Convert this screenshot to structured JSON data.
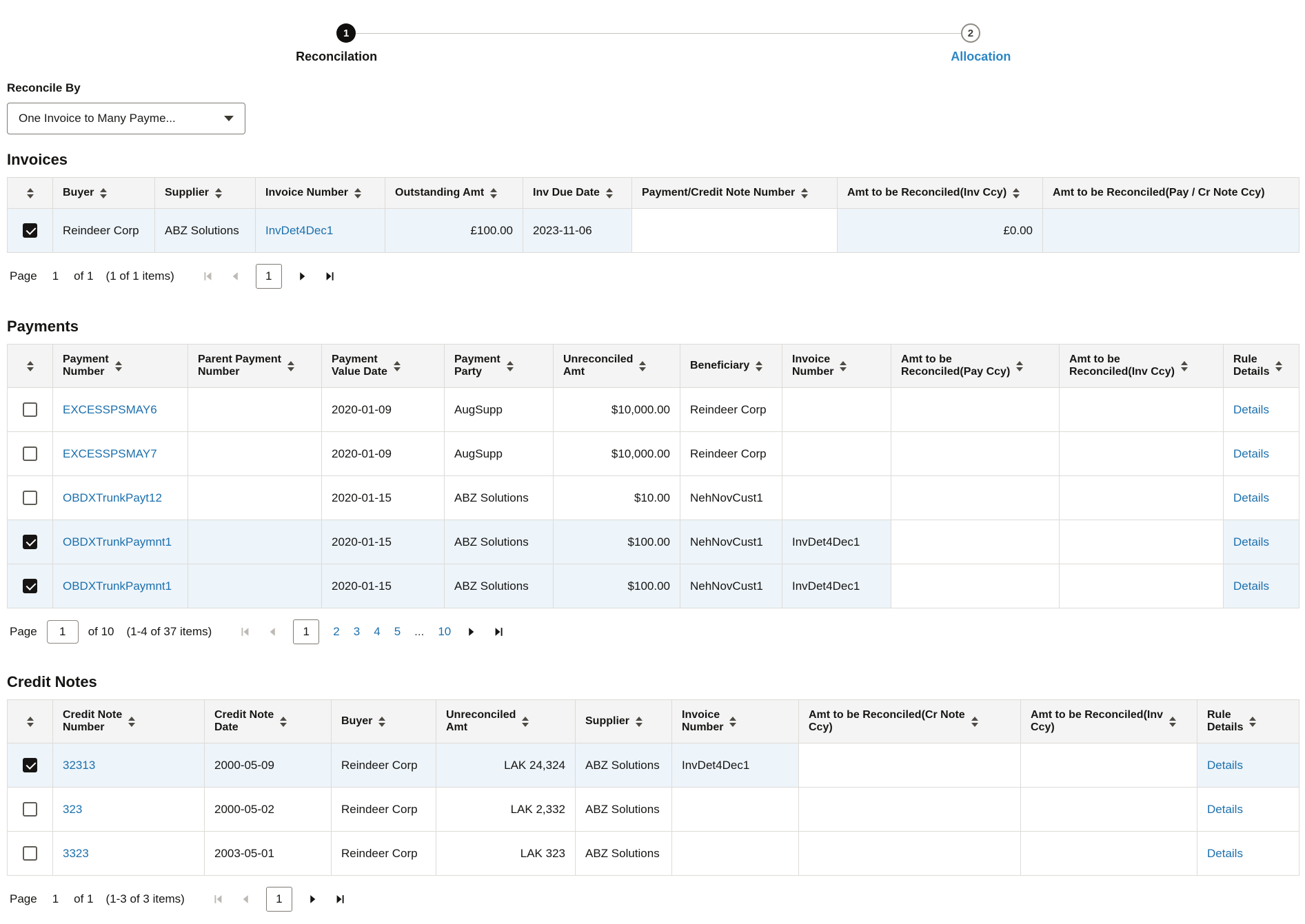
{
  "colors": {
    "link": "#1C70AD",
    "selected-row-bg": "#EDF4FA",
    "header-bg": "#F4F4F4",
    "step-active-bg": "#100F0E",
    "step-label-next": "#2B86C4",
    "border": "#DEDBD7",
    "text": "#161513"
  },
  "stepper": {
    "steps": [
      {
        "number": "1",
        "label": "Reconcilation"
      },
      {
        "number": "2",
        "label": "Allocation"
      }
    ]
  },
  "reconcile_by": {
    "label": "Reconcile By",
    "value": "One Invoice to Many Payme..."
  },
  "invoices": {
    "title": "Invoices",
    "columns": [
      "Buyer",
      "Supplier",
      "Invoice Number",
      "Outstanding Amt",
      "Inv Due Date",
      "Payment/Credit Note Number",
      "Amt to be Reconciled(Inv Ccy)",
      "Amt to be Reconciled(Pay / Cr Note Ccy)"
    ],
    "rows": [
      {
        "checked": true,
        "buyer": "Reindeer Corp",
        "supplier": "ABZ Solutions",
        "invoice_number": "InvDet4Dec1",
        "outstanding_amt": "£100.00",
        "inv_due_date": "2023-11-06",
        "payment_credit_note_number": "",
        "amt_to_be_reconciled_inv_ccy": "£0.00",
        "amt_to_be_reconciled_pay_cr_note_ccy": ""
      }
    ],
    "pagination": {
      "page_label": "Page",
      "page_value": "1",
      "of_label": "of 1",
      "items_label": "(1 of 1 items)",
      "current_page": "1"
    }
  },
  "payments": {
    "title": "Payments",
    "columns": [
      "Payment\nNumber",
      "Parent Payment\nNumber",
      "Payment\nValue Date",
      "Payment\nParty",
      "Unreconciled\nAmt",
      "Beneficiary",
      "Invoice\nNumber",
      "Amt to be\nReconciled(Pay Ccy)",
      "Amt to be\nReconciled(Inv Ccy)",
      "Rule\nDetails"
    ],
    "rows": [
      {
        "checked": false,
        "payment_number": "EXCESSPSMAY6",
        "parent_payment_number": "",
        "payment_value_date": "2020-01-09",
        "payment_party": "AugSupp",
        "unreconciled_amt": "$10,000.00",
        "beneficiary": "Reindeer Corp",
        "invoice_number": "",
        "amt_to_be_reconciled_pay_ccy": "",
        "amt_to_be_reconciled_inv_ccy": "",
        "rule_details": "Details"
      },
      {
        "checked": false,
        "payment_number": "EXCESSPSMAY7",
        "parent_payment_number": "",
        "payment_value_date": "2020-01-09",
        "payment_party": "AugSupp",
        "unreconciled_amt": "$10,000.00",
        "beneficiary": "Reindeer Corp",
        "invoice_number": "",
        "amt_to_be_reconciled_pay_ccy": "",
        "amt_to_be_reconciled_inv_ccy": "",
        "rule_details": "Details"
      },
      {
        "checked": false,
        "payment_number": "OBDXTrunkPayt12",
        "parent_payment_number": "",
        "payment_value_date": "2020-01-15",
        "payment_party": "ABZ Solutions",
        "unreconciled_amt": "$10.00",
        "beneficiary": "NehNovCust1",
        "invoice_number": "",
        "amt_to_be_reconciled_pay_ccy": "",
        "amt_to_be_reconciled_inv_ccy": "",
        "rule_details": "Details"
      },
      {
        "checked": true,
        "payment_number": "OBDXTrunkPaymnt1",
        "parent_payment_number": "",
        "payment_value_date": "2020-01-15",
        "payment_party": "ABZ Solutions",
        "unreconciled_amt": "$100.00",
        "beneficiary": "NehNovCust1",
        "invoice_number": "InvDet4Dec1",
        "amt_to_be_reconciled_pay_ccy": "",
        "amt_to_be_reconciled_inv_ccy": "",
        "rule_details": "Details"
      },
      {
        "checked": true,
        "payment_number": "OBDXTrunkPaymnt1",
        "parent_payment_number": "",
        "payment_value_date": "2020-01-15",
        "payment_party": "ABZ Solutions",
        "unreconciled_amt": "$100.00",
        "beneficiary": "NehNovCust1",
        "invoice_number": "InvDet4Dec1",
        "amt_to_be_reconciled_pay_ccy": "",
        "amt_to_be_reconciled_inv_ccy": "",
        "rule_details": "Details"
      }
    ],
    "pagination": {
      "page_label": "Page",
      "page_value": "1",
      "of_label": "of 10",
      "items_label": "(1-4 of 37 items)",
      "current_page": "1",
      "pages": [
        "2",
        "3",
        "4",
        "5"
      ],
      "ellipsis": "...",
      "last_page": "10"
    }
  },
  "credit_notes": {
    "title": "Credit Notes",
    "columns": [
      "Credit Note\nNumber",
      "Credit Note\nDate",
      "Buyer",
      "Unreconciled\nAmt",
      "Supplier",
      "Invoice\nNumber",
      "Amt to be Reconciled(Cr Note\nCcy)",
      "Amt to be Reconciled(Inv\nCcy)",
      "Rule\nDetails"
    ],
    "rows": [
      {
        "checked": true,
        "credit_note_number": "32313",
        "credit_note_date": "2000-05-09",
        "buyer": "Reindeer Corp",
        "unreconciled_amt": "LAK 24,324",
        "supplier": "ABZ Solutions",
        "invoice_number": "InvDet4Dec1",
        "amt_to_be_reconciled_cr_note_ccy": "",
        "amt_to_be_reconciled_inv_ccy": "",
        "rule_details": "Details"
      },
      {
        "checked": false,
        "credit_note_number": "323",
        "credit_note_date": "2000-05-02",
        "buyer": "Reindeer Corp",
        "unreconciled_amt": "LAK 2,332",
        "supplier": "ABZ Solutions",
        "invoice_number": "",
        "amt_to_be_reconciled_cr_note_ccy": "",
        "amt_to_be_reconciled_inv_ccy": "",
        "rule_details": "Details"
      },
      {
        "checked": false,
        "credit_note_number": "3323",
        "credit_note_date": "2003-05-01",
        "buyer": "Reindeer Corp",
        "unreconciled_amt": "LAK 323",
        "supplier": "ABZ Solutions",
        "invoice_number": "",
        "amt_to_be_reconciled_cr_note_ccy": "",
        "amt_to_be_reconciled_inv_ccy": "",
        "rule_details": "Details"
      }
    ],
    "pagination": {
      "page_label": "Page",
      "page_value": "1",
      "of_label": "of 1",
      "items_label": "(1-3 of 3 items)",
      "current_page": "1"
    }
  }
}
